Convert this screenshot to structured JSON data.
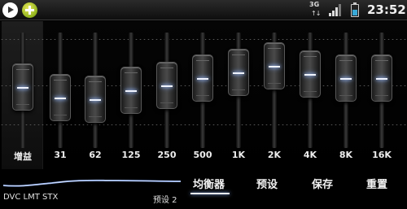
{
  "status_bar": {
    "network": "3G",
    "network_arrows": "↑↓",
    "time": "23:52",
    "battery_level": 0.55,
    "signal_level": 0.8,
    "icons": [
      "play-icon",
      "app-plus-icon",
      "network-3g-icon",
      "signal-icon",
      "battery-icon"
    ]
  },
  "equalizer": {
    "gain": {
      "label": "增益",
      "level": 0.53
    },
    "bands": [
      {
        "label": "31",
        "level": 0.43
      },
      {
        "label": "62",
        "level": 0.41
      },
      {
        "label": "125",
        "level": 0.5
      },
      {
        "label": "250",
        "level": 0.55
      },
      {
        "label": "500",
        "level": 0.62
      },
      {
        "label": "1K",
        "level": 0.68
      },
      {
        "label": "2K",
        "level": 0.74
      },
      {
        "label": "4K",
        "level": 0.66
      },
      {
        "label": "8K",
        "level": 0.62
      },
      {
        "label": "16K",
        "level": 0.62
      }
    ],
    "accent_color": "#f0f4ff"
  },
  "bottom": {
    "modes": "DVC LMT STX",
    "preset_name": "预设 2",
    "tabs": {
      "equalizer": "均衡器",
      "presets": "预设",
      "save": "保存",
      "reset": "重置"
    },
    "active_tab": "equalizer"
  }
}
